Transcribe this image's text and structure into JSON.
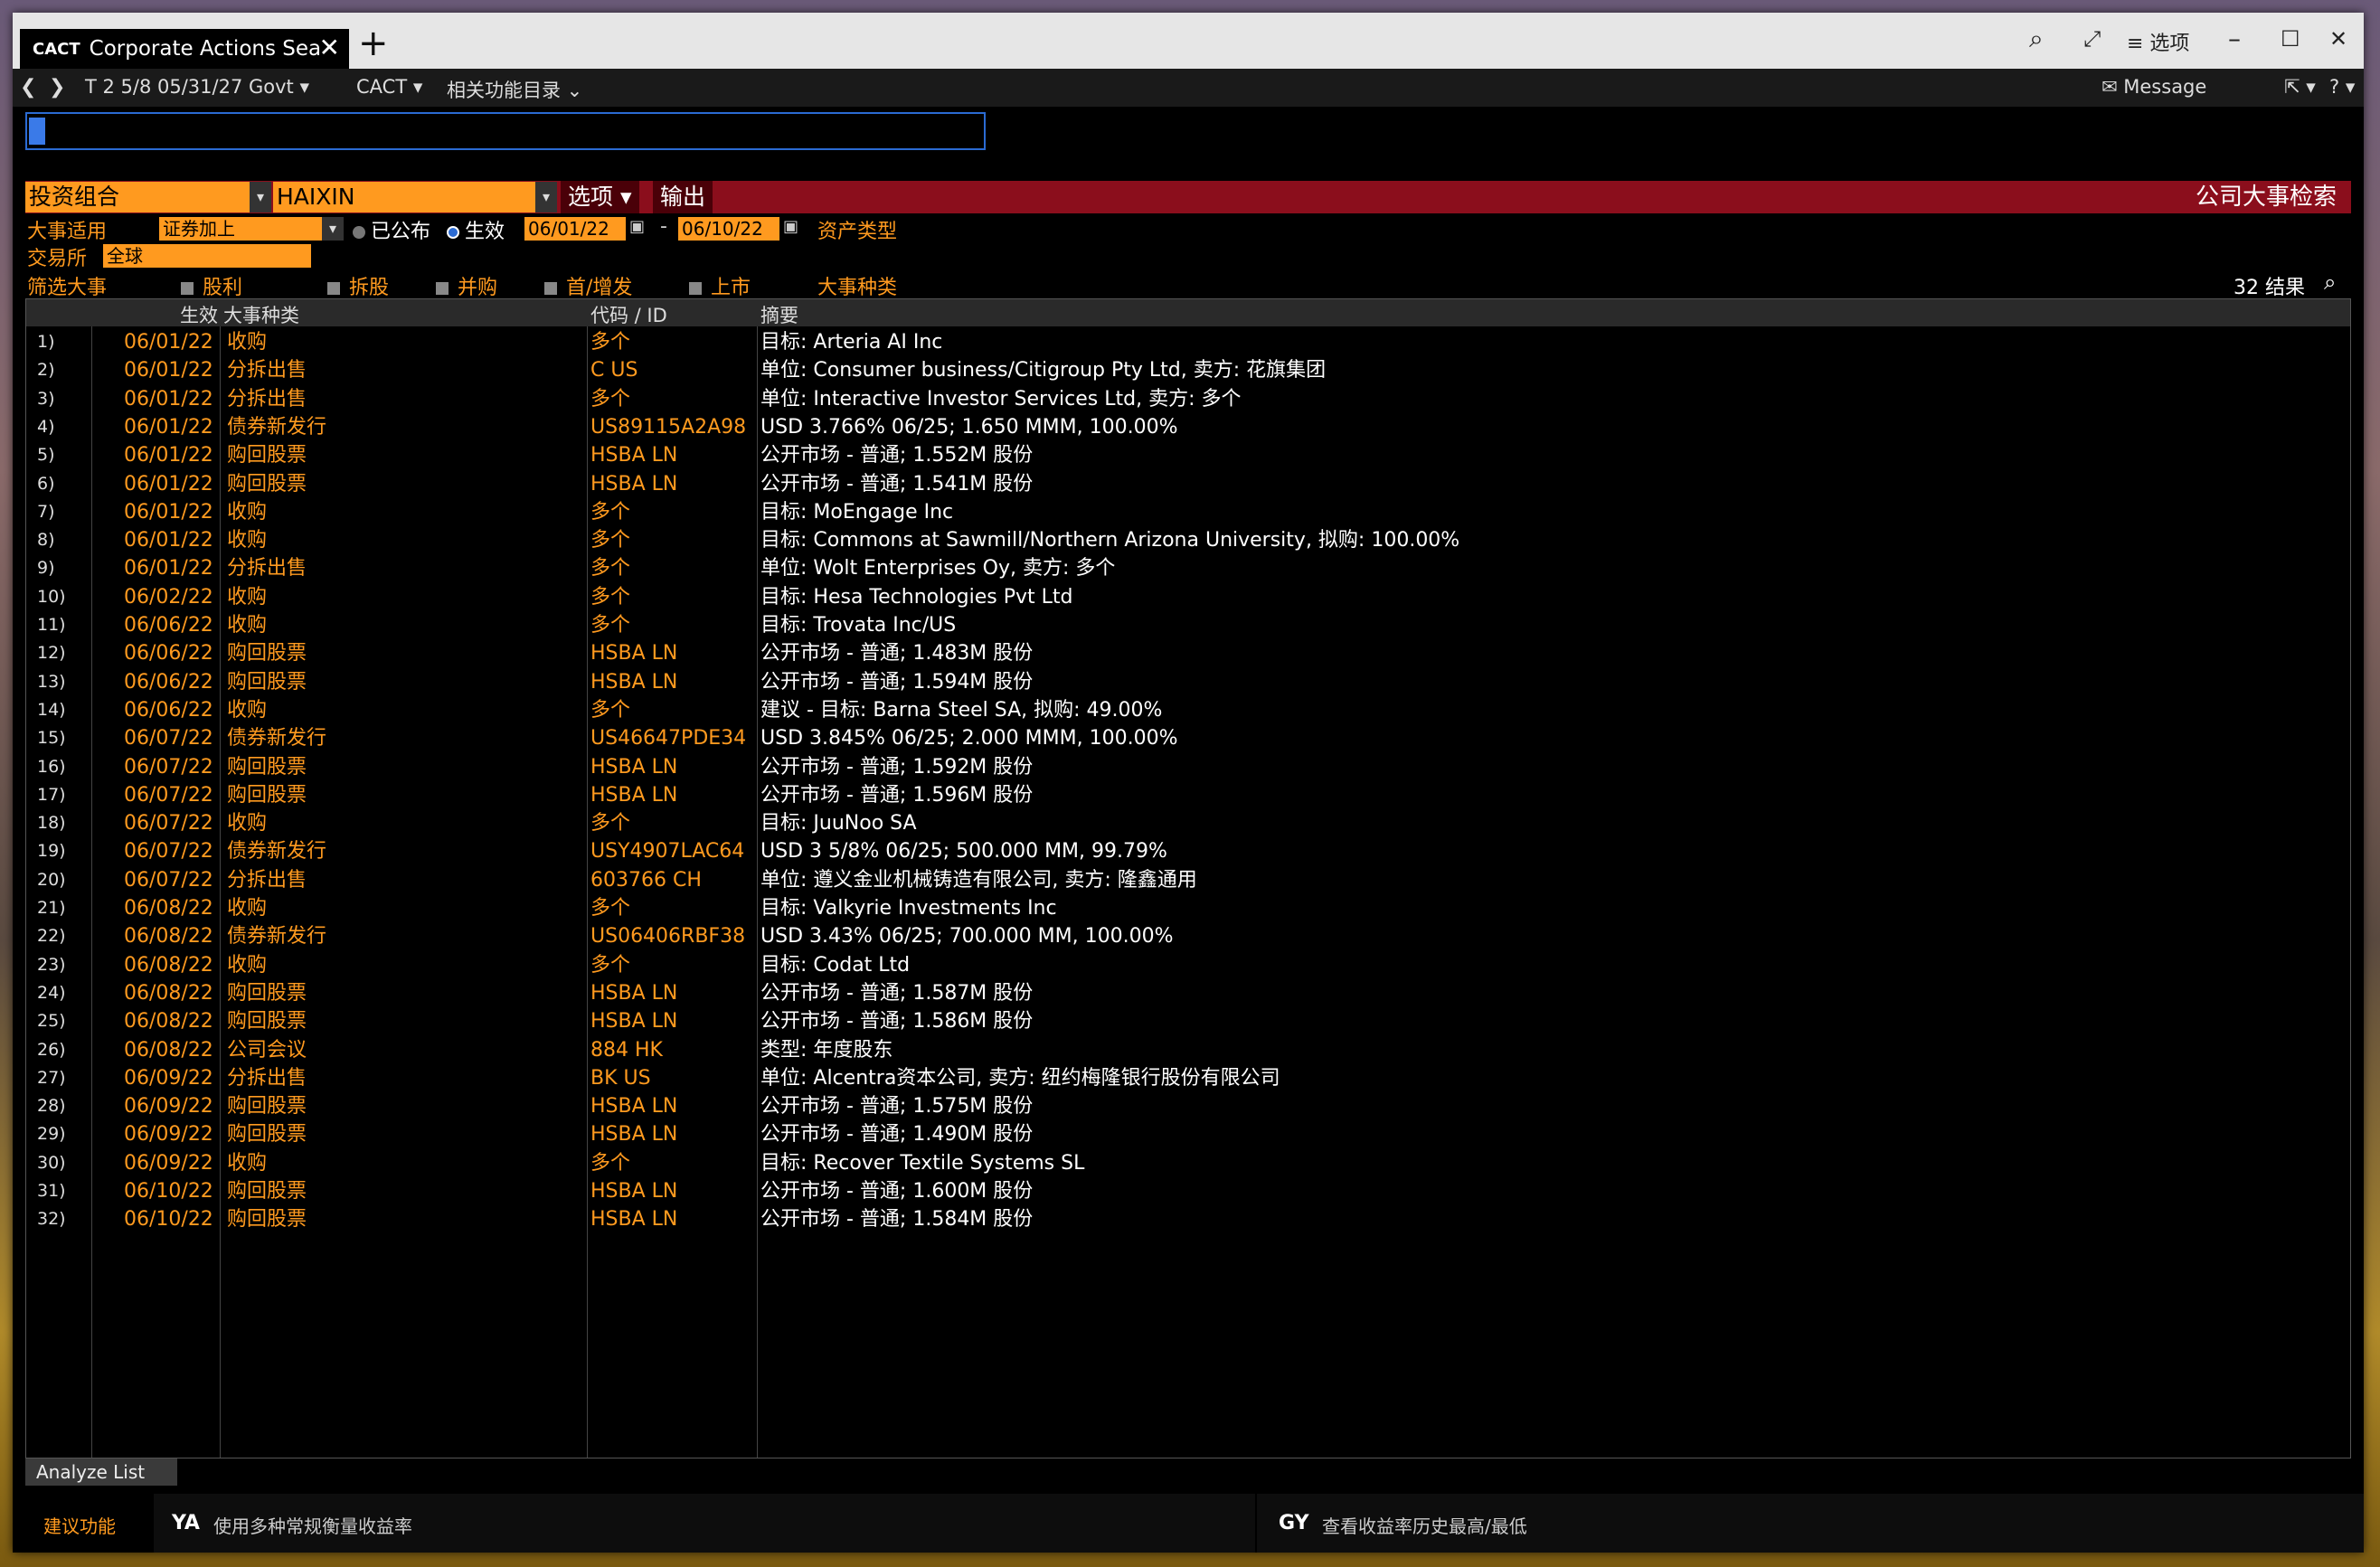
{
  "window": {
    "tab_code": "CACT",
    "tab_title": "Corporate Actions Search",
    "options_label": "≡ 选项"
  },
  "nav": {
    "security": "T 2 5/8 05/31/27 Govt ▾",
    "function": "CACT ▾",
    "related": "相关功能目录 ⌄",
    "message": "✉ Message",
    "help": "? ▾"
  },
  "command_input": {
    "value": ""
  },
  "header": {
    "portfolio_label": "投资组合",
    "portfolio_value": "HAIXIN",
    "options_button": "选项 ▾",
    "export_button": "输出",
    "function_title": "公司大事检索"
  },
  "filters": {
    "event_applies_label": "大事适用",
    "event_applies_value": "证券加上",
    "announced_label": "已公布",
    "effective_label": "生效",
    "date_from": "06/01/22",
    "date_sep": "-",
    "date_to": "06/10/22",
    "asset_type_label": "资产类型",
    "exchange_label": "交易所",
    "exchange_value": "全球",
    "filter_events_label": "筛选大事",
    "checkboxes": [
      "股利",
      "拆股",
      "并购",
      "首/增发",
      "上市"
    ],
    "event_type_label": "大事种类",
    "result_count": "32 结果"
  },
  "table": {
    "columns": [
      "生效",
      "大事种类",
      "代码 / ID",
      "摘要"
    ],
    "rows": [
      {
        "num": "1)",
        "date": "06/01/22",
        "type": "收购",
        "code": "多个",
        "summary": "目标: Arteria AI Inc"
      },
      {
        "num": "2)",
        "date": "06/01/22",
        "type": "分拆出售",
        "code": "C US",
        "summary": "单位: Consumer business/Citigroup Pty Ltd, 卖方: 花旗集团"
      },
      {
        "num": "3)",
        "date": "06/01/22",
        "type": "分拆出售",
        "code": "多个",
        "summary": "单位: Interactive Investor Services Ltd, 卖方: 多个"
      },
      {
        "num": "4)",
        "date": "06/01/22",
        "type": "债券新发行",
        "code": "US89115A2A98",
        "summary": "USD 3.766% 06/25; 1.650 MMM, 100.00%"
      },
      {
        "num": "5)",
        "date": "06/01/22",
        "type": "购回股票",
        "code": "HSBA LN",
        "summary": "公开市场 - 普通; 1.552M 股份"
      },
      {
        "num": "6)",
        "date": "06/01/22",
        "type": "购回股票",
        "code": "HSBA LN",
        "summary": "公开市场 - 普通; 1.541M 股份"
      },
      {
        "num": "7)",
        "date": "06/01/22",
        "type": "收购",
        "code": "多个",
        "summary": "目标: MoEngage Inc"
      },
      {
        "num": "8)",
        "date": "06/01/22",
        "type": "收购",
        "code": "多个",
        "summary": "目标: Commons at Sawmill/Northern Arizona University, 拟购: 100.00%"
      },
      {
        "num": "9)",
        "date": "06/01/22",
        "type": "分拆出售",
        "code": "多个",
        "summary": "单位: Wolt Enterprises Oy, 卖方: 多个"
      },
      {
        "num": "10)",
        "date": "06/02/22",
        "type": "收购",
        "code": "多个",
        "summary": "目标: Hesa Technologies Pvt Ltd"
      },
      {
        "num": "11)",
        "date": "06/06/22",
        "type": "收购",
        "code": "多个",
        "summary": "目标: Trovata Inc/US"
      },
      {
        "num": "12)",
        "date": "06/06/22",
        "type": "购回股票",
        "code": "HSBA LN",
        "summary": "公开市场 - 普通; 1.483M 股份"
      },
      {
        "num": "13)",
        "date": "06/06/22",
        "type": "购回股票",
        "code": "HSBA LN",
        "summary": "公开市场 - 普通; 1.594M 股份"
      },
      {
        "num": "14)",
        "date": "06/06/22",
        "type": "收购",
        "code": "多个",
        "summary": "建议 - 目标: Barna Steel SA, 拟购: 49.00%"
      },
      {
        "num": "15)",
        "date": "06/07/22",
        "type": "债券新发行",
        "code": "US46647PDE34",
        "summary": "USD 3.845% 06/25; 2.000 MMM, 100.00%"
      },
      {
        "num": "16)",
        "date": "06/07/22",
        "type": "购回股票",
        "code": "HSBA LN",
        "summary": "公开市场 - 普通; 1.592M 股份"
      },
      {
        "num": "17)",
        "date": "06/07/22",
        "type": "购回股票",
        "code": "HSBA LN",
        "summary": "公开市场 - 普通; 1.596M 股份"
      },
      {
        "num": "18)",
        "date": "06/07/22",
        "type": "收购",
        "code": "多个",
        "summary": "目标: JuuNoo SA"
      },
      {
        "num": "19)",
        "date": "06/07/22",
        "type": "债券新发行",
        "code": "USY4907LAC64",
        "summary": "USD 3 5/8% 06/25; 500.000 MM, 99.79%"
      },
      {
        "num": "20)",
        "date": "06/07/22",
        "type": "分拆出售",
        "code": "603766 CH",
        "summary": "单位: 遵义金业机械铸造有限公司, 卖方: 隆鑫通用"
      },
      {
        "num": "21)",
        "date": "06/08/22",
        "type": "收购",
        "code": "多个",
        "summary": "目标: Valkyrie Investments Inc"
      },
      {
        "num": "22)",
        "date": "06/08/22",
        "type": "债券新发行",
        "code": "US06406RBF38",
        "summary": "USD 3.43% 06/25; 700.000 MM, 100.00%"
      },
      {
        "num": "23)",
        "date": "06/08/22",
        "type": "收购",
        "code": "多个",
        "summary": "目标: Codat Ltd"
      },
      {
        "num": "24)",
        "date": "06/08/22",
        "type": "购回股票",
        "code": "HSBA LN",
        "summary": "公开市场 - 普通; 1.587M 股份"
      },
      {
        "num": "25)",
        "date": "06/08/22",
        "type": "购回股票",
        "code": "HSBA LN",
        "summary": "公开市场 - 普通; 1.586M 股份"
      },
      {
        "num": "26)",
        "date": "06/08/22",
        "type": "公司会议",
        "code": "884 HK",
        "summary": "类型: 年度股东"
      },
      {
        "num": "27)",
        "date": "06/09/22",
        "type": "分拆出售",
        "code": "BK US",
        "summary": "单位: Alcentra资本公司, 卖方: 纽约梅隆银行股份有限公司"
      },
      {
        "num": "28)",
        "date": "06/09/22",
        "type": "购回股票",
        "code": "HSBA LN",
        "summary": "公开市场 - 普通; 1.575M 股份"
      },
      {
        "num": "29)",
        "date": "06/09/22",
        "type": "购回股票",
        "code": "HSBA LN",
        "summary": "公开市场 - 普通; 1.490M 股份"
      },
      {
        "num": "30)",
        "date": "06/09/22",
        "type": "收购",
        "code": "多个",
        "summary": "目标: Recover Textile Systems SL"
      },
      {
        "num": "31)",
        "date": "06/10/22",
        "type": "购回股票",
        "code": "HSBA LN",
        "summary": "公开市场 - 普通; 1.600M 股份"
      },
      {
        "num": "32)",
        "date": "06/10/22",
        "type": "购回股票",
        "code": "HSBA LN",
        "summary": "公开市场 - 普通; 1.584M 股份"
      }
    ]
  },
  "analyze_button": "Analyze List",
  "suggestions": {
    "label": "建议功能",
    "items": [
      {
        "code": "YA",
        "text": "使用多种常规衡量收益率"
      },
      {
        "code": "GY",
        "text": "查看收益率历史最高/最低"
      }
    ]
  },
  "colors": {
    "accent": "#ff9a1f",
    "header_red": "#8b0e1c",
    "input_border": "#2b6bd3"
  }
}
